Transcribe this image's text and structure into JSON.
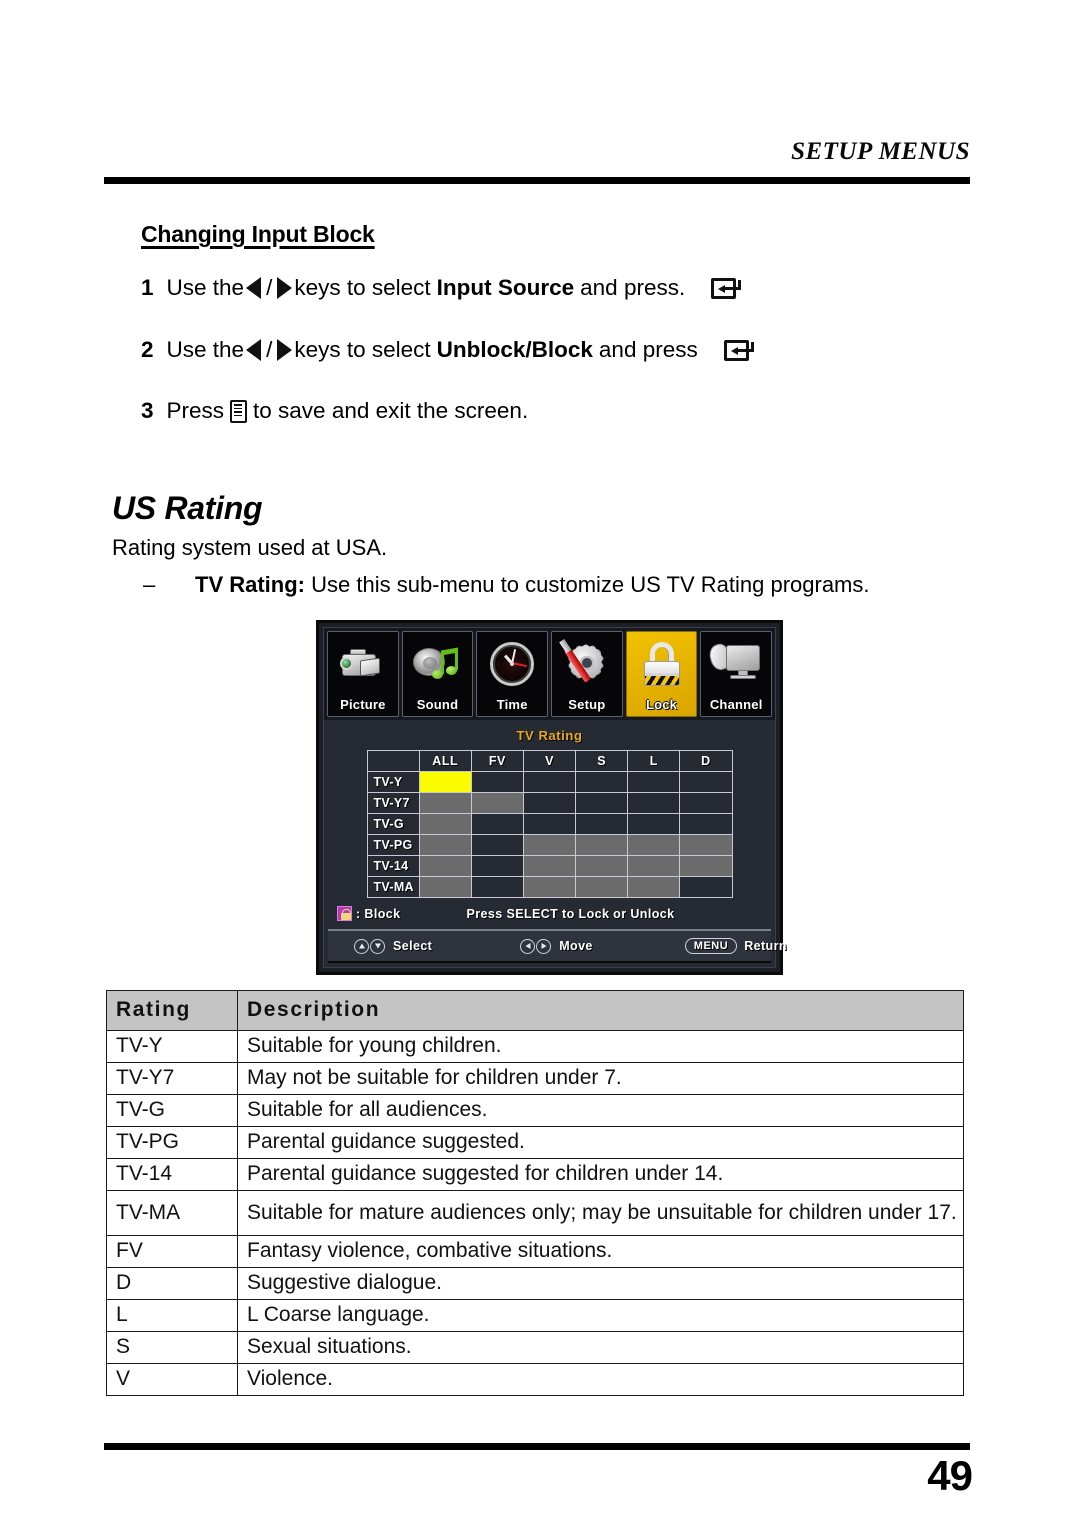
{
  "header": {
    "title": "SETUP MENUS"
  },
  "section": {
    "subheading": "Changing Input Block",
    "steps": [
      {
        "num": "1",
        "pre": "Use the",
        "mid": "keys to select",
        "bold": "Input Source",
        "post": "and press.",
        "enter_icon": "enter-key-icon"
      },
      {
        "num": "2",
        "pre": "Use the",
        "mid": "keys to select",
        "bold": "Unblock/Block",
        "post": "and press",
        "enter_icon": "enter-key-icon"
      },
      {
        "num": "3",
        "pre": "Press",
        "post": "to save and exit the screen.",
        "menu_icon": "menu-key-icon"
      }
    ]
  },
  "us_rating": {
    "title": "US Rating",
    "description": "Rating system used at USA.",
    "bullet_dash": "–",
    "bullet_bold": "TV Rating:",
    "bullet_text": "Use this sub-menu to customize US TV Rating programs."
  },
  "osd": {
    "menu_icons": [
      {
        "label": "Picture",
        "icon": "camcorder-icon",
        "active": false
      },
      {
        "label": "Sound",
        "icon": "speaker-music-note-icon",
        "active": false
      },
      {
        "label": "Time",
        "icon": "clock-icon",
        "active": false
      },
      {
        "label": "Setup",
        "icon": "gear-screwdriver-icon",
        "active": false
      },
      {
        "label": "Lock",
        "icon": "padlock-icon",
        "active": true
      },
      {
        "label": "Channel",
        "icon": "satellite-tv-icon",
        "active": false
      }
    ],
    "heading": "TV Rating",
    "columns": [
      "ALL",
      "FV",
      "V",
      "S",
      "L",
      "D"
    ],
    "rows": [
      {
        "label": "TV-Y",
        "cells": [
          "sel",
          "dark",
          "dark",
          "dark",
          "dark",
          "dark"
        ]
      },
      {
        "label": "TV-Y7",
        "cells": [
          "gray",
          "gray",
          "dark",
          "dark",
          "dark",
          "dark"
        ]
      },
      {
        "label": "TV-G",
        "cells": [
          "gray",
          "dark",
          "dark",
          "dark",
          "dark",
          "dark"
        ]
      },
      {
        "label": "TV-PG",
        "cells": [
          "gray",
          "dark",
          "gray",
          "gray",
          "gray",
          "gray"
        ]
      },
      {
        "label": "TV-14",
        "cells": [
          "gray",
          "dark",
          "gray",
          "gray",
          "gray",
          "gray"
        ]
      },
      {
        "label": "TV-MA",
        "cells": [
          "gray",
          "dark",
          "gray",
          "gray",
          "gray",
          "dark"
        ]
      }
    ],
    "legend_label": ": Block",
    "legend_icon": "block-lock-icon",
    "legend_hint": "Press SELECT to Lock or Unlock",
    "footer": [
      {
        "label": "Select",
        "icons": [
          "arrow-up-icon",
          "arrow-down-icon"
        ]
      },
      {
        "label": "Move",
        "icons": [
          "arrow-left-icon",
          "arrow-right-icon"
        ]
      },
      {
        "label": "Return",
        "pill": "MENU"
      }
    ],
    "colors": {
      "selected_cell": "#fcfc00",
      "blocked_cell": "#6b6b6b",
      "unblocked_cell": "#262a33",
      "heading": "#e8a91d",
      "active_tab": "#e8b400"
    }
  },
  "rating_table": {
    "columns": [
      "Rating",
      "Description"
    ],
    "rows": [
      {
        "rating": "TV-Y",
        "description": "Suitable for young children."
      },
      {
        "rating": "TV-Y7",
        "description": "May not be suitable for children under 7."
      },
      {
        "rating": "TV-G",
        "description": "Suitable for all audiences."
      },
      {
        "rating": "TV-PG",
        "description": "Parental guidance suggested."
      },
      {
        "rating": "TV-14",
        "description": "Parental guidance suggested for children under 14."
      },
      {
        "rating": "TV-MA",
        "description": "Suitable for mature audiences only; may be unsuitable for children under 17."
      },
      {
        "rating": "FV",
        "description": "Fantasy violence, combative situations."
      },
      {
        "rating": "D",
        "description": "Suggestive dialogue."
      },
      {
        "rating": "L",
        "description": "L Coarse language."
      },
      {
        "rating": "S",
        "description": "Sexual situations."
      },
      {
        "rating": "V",
        "description": "Violence."
      }
    ]
  },
  "footer": {
    "page_number": "49"
  }
}
